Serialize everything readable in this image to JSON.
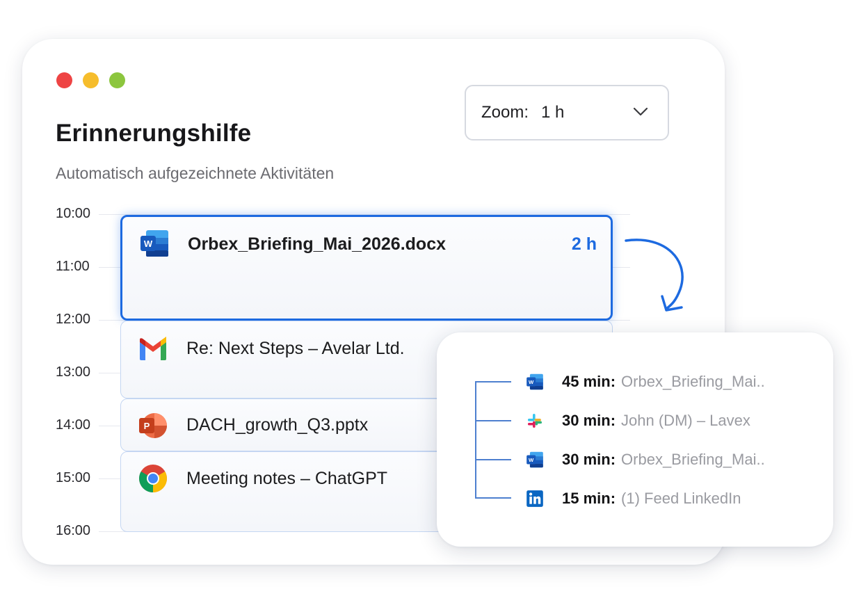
{
  "window": {
    "title": "Erinnerungshilfe",
    "subtitle": "Automatisch aufgezeichnete Aktivitäten"
  },
  "zoom": {
    "label": "Zoom:",
    "value": "1 h",
    "icon": "chevron-down-icon"
  },
  "timeline": {
    "times": [
      "10:00",
      "11:00",
      "12:00",
      "13:00",
      "14:00",
      "15:00",
      "16:00"
    ],
    "events": [
      {
        "app": "word",
        "icon": "word-icon",
        "label": "Orbex_Briefing_Mai_2026.docx",
        "duration": "2 h",
        "selected": true
      },
      {
        "app": "gmail",
        "icon": "gmail-icon",
        "label": "Re: Next Steps – Avelar Ltd."
      },
      {
        "app": "powerpoint",
        "icon": "powerpoint-icon",
        "label": "DACH_growth_Q3.pptx"
      },
      {
        "app": "chrome",
        "icon": "chrome-icon",
        "label": "Meeting notes – ChatGPT"
      }
    ]
  },
  "breakdown": {
    "items": [
      {
        "icon": "word-icon",
        "duration": "45 min:",
        "name": "Orbex_Briefing_Mai.."
      },
      {
        "icon": "slack-icon",
        "duration": "30 min:",
        "name": "John (DM) – Lavex"
      },
      {
        "icon": "word-icon",
        "duration": "30 min:",
        "name": "Orbex_Briefing_Mai.."
      },
      {
        "icon": "linkedin-icon",
        "duration": "15 min:",
        "name": "(1) Feed LinkedIn"
      }
    ]
  },
  "colors": {
    "accent": "#1d6ae0",
    "traffic_red": "#ee4444",
    "traffic_yellow": "#f6bd2c",
    "traffic_green": "#8cc63e"
  }
}
